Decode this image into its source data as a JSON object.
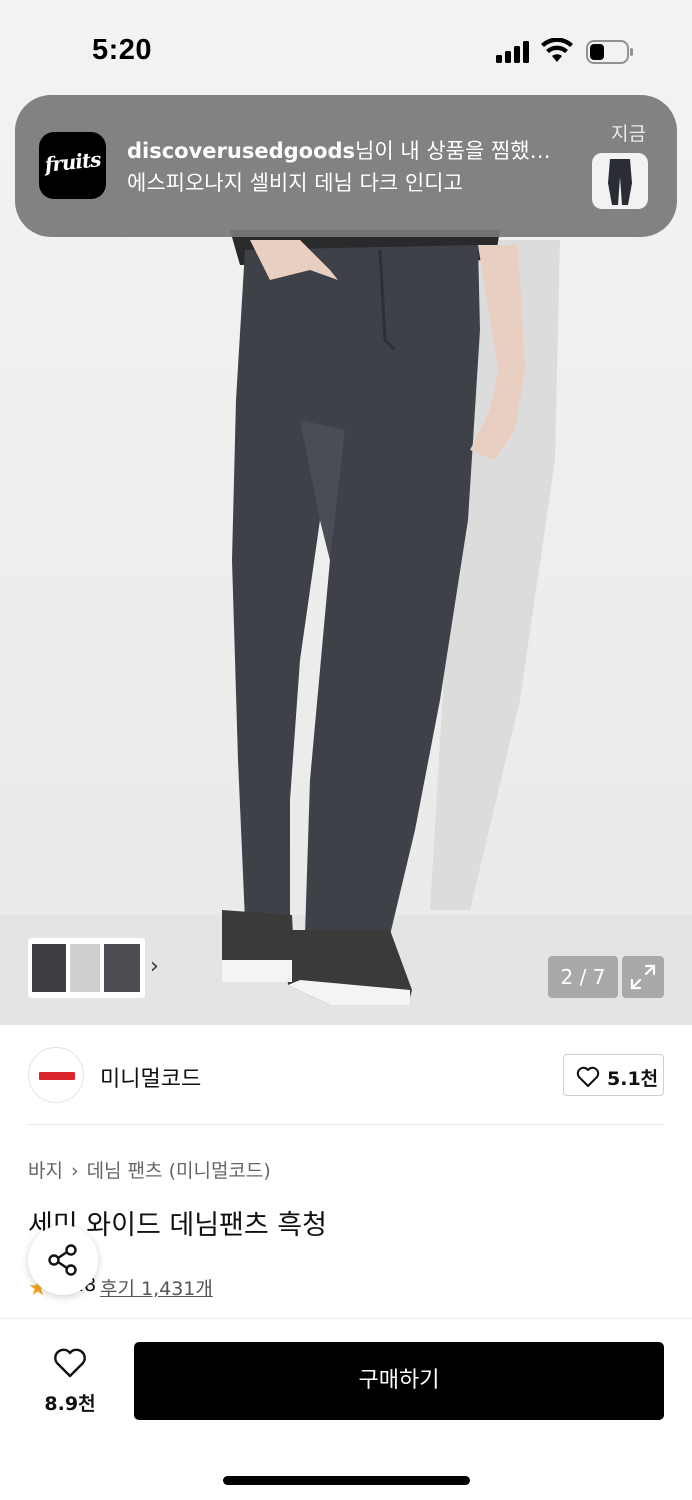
{
  "status_bar": {
    "time": "5:20"
  },
  "notification": {
    "app_icon_text": "fruits",
    "username": "discoverusedgoods",
    "message": "님이 내 상품을 찜했…",
    "product": "에스피오나지 셀비지 데님 다크 인디고",
    "time": "지금"
  },
  "gallery": {
    "page_indicator": "2 / 7",
    "thumbnail_chevron": "›"
  },
  "brand": {
    "name": "미니멀코드",
    "like_count": "5.1천"
  },
  "breadcrumb": {
    "category": "바지",
    "separator": "›",
    "subcategory": "데님 팬츠 (미니멀코드)"
  },
  "product": {
    "title": "세미 와이드 데님팬츠 흑청",
    "rating": "4.8",
    "reviews": "후기 1,431개"
  },
  "bottom_bar": {
    "wish_count": "8.9천",
    "buy_label": "구매하기"
  },
  "colors": {
    "brand_logo_red": "#d9252b",
    "star": "#f5a623",
    "buy_button": "#000000"
  }
}
